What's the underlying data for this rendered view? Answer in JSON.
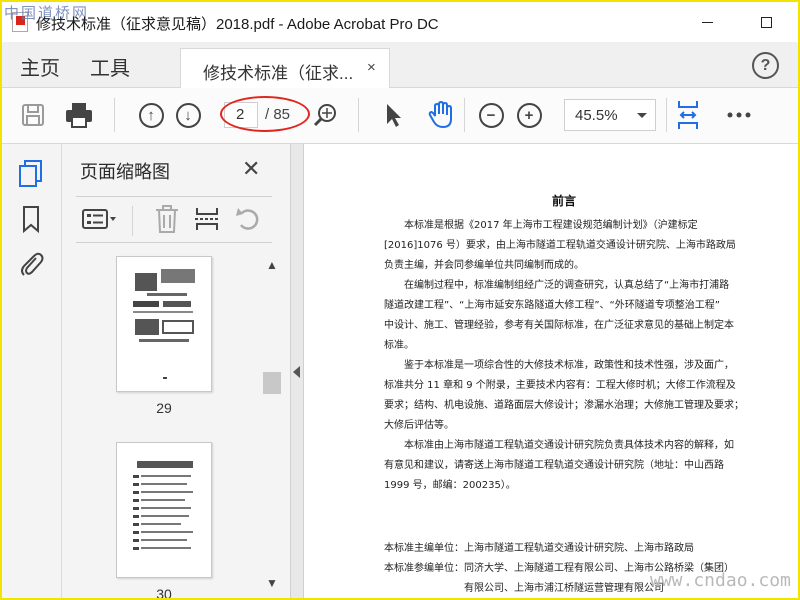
{
  "window": {
    "title": "修技术标准（征求意见稿）2018.pdf - Adobe Acrobat Pro DC",
    "watermark_top_left": "中国道桥网"
  },
  "tabs": {
    "home": "主页",
    "tools": "工具",
    "document": "修技术标准（征求...",
    "close": "×",
    "help": "?"
  },
  "toolbar": {
    "page_current": "2",
    "page_total": "/ 85",
    "zoom": "45.5%"
  },
  "panel": {
    "title": "页面缩略图",
    "close": "✕",
    "thumbnails": [
      {
        "label": "29"
      },
      {
        "label": "30"
      }
    ]
  },
  "document": {
    "heading": "前言",
    "paragraphs": [
      "本标准是根据《2017 年上海市工程建设规范编制计划》（沪建标定",
      "[2016]1076 号）要求，由上海市隧道工程轨道交通设计研究院、上海市路政局",
      "负责主编，并会同参编单位共同编制而成的。",
      "在编制过程中，标准编制组经广泛的调查研究，认真总结了“上海市打浦路",
      "隧道改建工程”、“上海市延安东路隧道大修工程”、“外环隧道专项整治工程”",
      "中设计、施工、管理经验，参考有关国际标准，在广泛征求意见的基础上制定本",
      "标准。",
      "鉴于本标准是一项综合性的大修技术标准，政策性和技术性强，涉及面广，",
      "标准共分 11 章和 9 个附录，主要技术内容有：工程大修时机；大修工作流程及",
      "要求；结构、机电设施、道路面层大修设计；渗漏水治理；大修施工管理及要求；",
      "大修后评估等。",
      "本标准由上海市隧道工程轨道交通设计研究院负责具体技术内容的解释，如",
      "有意见和建议，请寄送上海市隧道工程轨道交通设计研究院（地址：中山西路",
      "1999 号，邮编：200235）。"
    ],
    "units": [
      "本标准主编单位：上海市隧道工程轨道交通设计研究院、上海市路政局",
      "本标准参编单位：同济大学、上海隧道工程有限公司、上海市公路桥梁（集团）",
      "有限公司、上海市浦江桥隧运营管理有限公司"
    ]
  },
  "watermark_bottom_right": "www.cndao.com",
  "colors": {
    "accent_blue": "#1f6ee6",
    "highlight_red": "#e0271e",
    "frame_yellow": "#f2e400"
  }
}
